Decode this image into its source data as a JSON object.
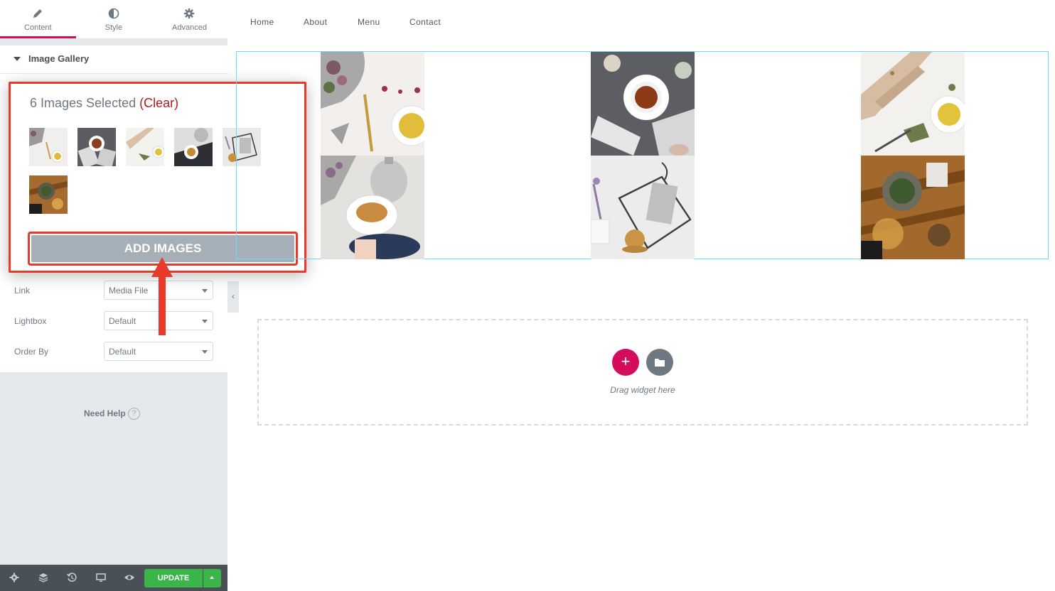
{
  "tabs": [
    {
      "label": "Content",
      "icon": "pencil-icon",
      "active": true
    },
    {
      "label": "Style",
      "icon": "half-circle-icon",
      "active": false
    },
    {
      "label": "Advanced",
      "icon": "gear-icon",
      "active": false
    }
  ],
  "section": {
    "title": "Image Gallery"
  },
  "gallery_panel": {
    "selected_text": "6 Images Selected",
    "clear_label": "(Clear)",
    "add_images_label": "ADD IMAGES"
  },
  "controls": [
    {
      "label": "Link",
      "value": "Media File"
    },
    {
      "label": "Lightbox",
      "value": "Default"
    },
    {
      "label": "Order By",
      "value": "Default"
    }
  ],
  "help": {
    "label": "Need Help",
    "icon_glyph": "?"
  },
  "footer": {
    "update_label": "UPDATE"
  },
  "nav": {
    "items": [
      "Home",
      "About",
      "Menu",
      "Contact"
    ]
  },
  "drop_zone": {
    "text": "Drag widget here",
    "add_glyph": "+"
  },
  "colors": {
    "accent": "#d30c5c",
    "update_green": "#39b54a",
    "highlight_red": "#e63a2a",
    "gallery_border": "#71d7f7",
    "add_images_gray": "#a4afb7"
  }
}
